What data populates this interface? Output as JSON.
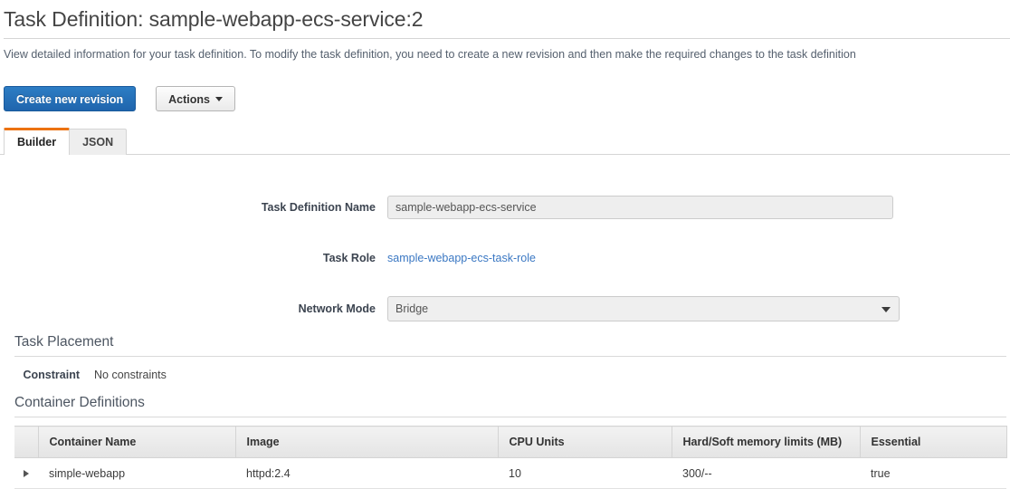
{
  "header": {
    "title": "Task Definition: sample-webapp-ecs-service:2",
    "subtitle": "View detailed information for your task definition. To modify the task definition, you need to create a new revision and then make the required changes to the task definition"
  },
  "actions": {
    "create_revision_label": "Create new revision",
    "actions_label": "Actions",
    "caret_icon": "caret-down-icon"
  },
  "tabs": [
    {
      "label": "Builder",
      "active": true
    },
    {
      "label": "JSON",
      "active": false
    }
  ],
  "form": {
    "task_definition_name": {
      "label": "Task Definition Name",
      "value": "sample-webapp-ecs-service",
      "placeholder": ""
    },
    "task_role": {
      "label": "Task Role",
      "value": "sample-webapp-ecs-task-role"
    },
    "network_mode": {
      "label": "Network Mode",
      "value": "Bridge",
      "arrow_icon": "chevron-down-icon"
    }
  },
  "task_placement": {
    "section_title": "Task Placement",
    "constraint_label": "Constraint",
    "constraint_value": "No constraints"
  },
  "container_definitions": {
    "section_title": "Container Definitions",
    "columns": [
      "Container Name",
      "Image",
      "CPU Units",
      "Hard/Soft memory limits (MB)",
      "Essential"
    ],
    "rows": [
      {
        "expander_icon": "expand-triangle-icon",
        "container_name": "simple-webapp",
        "image": "httpd:2.4",
        "cpu_units": "10",
        "memory_limits": "300/--",
        "essential": "true"
      }
    ]
  },
  "colors": {
    "primary_button": "#1f65ad",
    "active_tab_accent": "#ec7211",
    "link": "#3b78c3"
  }
}
